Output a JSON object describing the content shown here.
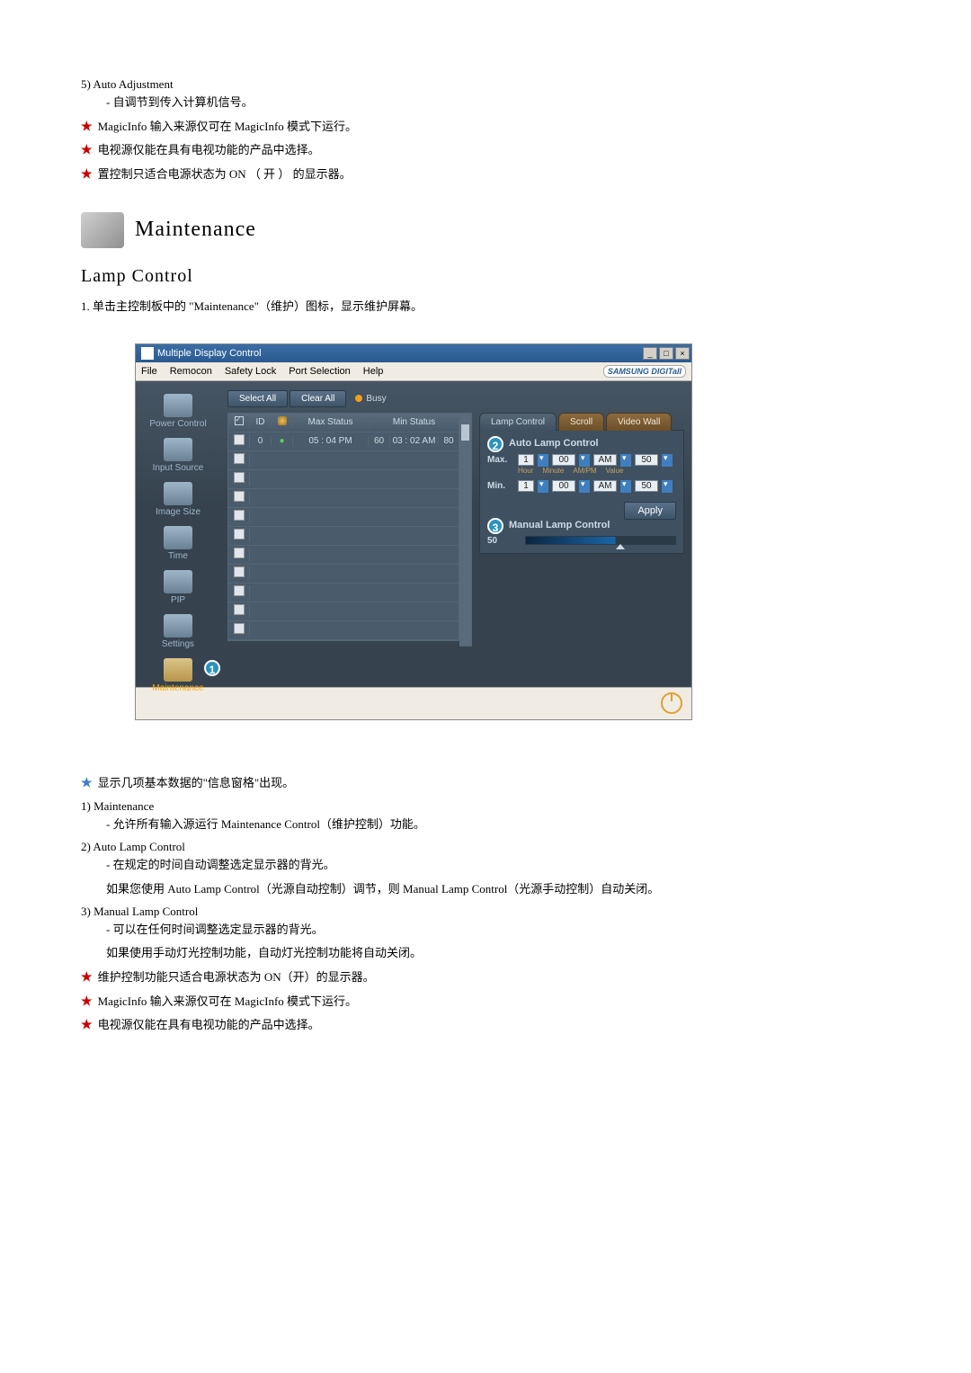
{
  "intro": {
    "item5_num": "5) Auto Adjustment",
    "item5_desc": "- 自调节到传入计算机信号。",
    "starA": "MagicInfo 输入来源仅可在 MagicInfo 模式下运行。",
    "starB": "电视源仅能在具有电视功能的产品中选择。",
    "starC": "置控制只适合电源状态为 ON （ 开 ） 的显示器。"
  },
  "section_title": "Maintenance",
  "subsection_title": "Lamp Control",
  "step1": "1.  单击主控制板中的 \"Maintenance\"（维护）图标，显示维护屏幕。",
  "window": {
    "title": "Multiple Display Control",
    "menu": {
      "file": "File",
      "remocon": "Remocon",
      "safety": "Safety Lock",
      "port": "Port Selection",
      "help": "Help"
    },
    "brand": "SAMSUNG DIGITall",
    "sidebar": {
      "power": "Power Control",
      "input": "Input Source",
      "image": "Image Size",
      "time": "Time",
      "pip": "PIP",
      "settings": "Settings",
      "maintenance": "Maintenance"
    },
    "buttons": {
      "selectall": "Select All",
      "clearall": "Clear All",
      "busy": "Busy"
    },
    "grid": {
      "h_id": "ID",
      "h_max": "Max Status",
      "h_min": "Min Status",
      "r_id": "0",
      "r_max": "05 : 04 PM",
      "r_maxv": "60",
      "r_min": "03 : 02 AM",
      "r_minv": "80"
    },
    "tabs": {
      "lamp": "Lamp Control",
      "scroll": "Scroll",
      "video": "Video Wall"
    },
    "auto": {
      "title": "Auto Lamp Control",
      "max": "Max.",
      "min": "Min.",
      "h1": "1",
      "m1": "00",
      "ap": "AM",
      "v1": "50",
      "sub_hour": "Hour",
      "sub_min": "Minute",
      "sub_ap": "AM/PM",
      "sub_val": "Value",
      "apply": "Apply"
    },
    "manual": {
      "title": "Manual Lamp Control",
      "val": "50"
    },
    "callout1": "1",
    "callout2": "2",
    "callout3": "3"
  },
  "below": {
    "star_top": "显示几项基本数据的\"信息窗格\"出现。",
    "item1_num": "1) Maintenance",
    "item1_desc": "- 允许所有输入源运行 Maintenance Control（维护控制）功能。",
    "item2_num": "2) Auto Lamp Control",
    "item2_desc1": "- 在规定的时间自动调整选定显示器的背光。",
    "item2_desc2": "  如果您使用 Auto Lamp Control（光源自动控制）调节，则 Manual Lamp Control（光源手动控制）自动关闭。",
    "item3_num": "3) Manual Lamp Control",
    "item3_desc1": "- 可以在任何时间调整选定显示器的背光。",
    "item3_desc2": "  如果使用手动灯光控制功能，自动灯光控制功能将自动关闭。",
    "starD": "维护控制功能只适合电源状态为 ON（开）的显示器。",
    "starE": "MagicInfo 输入来源仅可在 MagicInfo 模式下运行。",
    "starF": "电视源仅能在具有电视功能的产品中选择。"
  }
}
